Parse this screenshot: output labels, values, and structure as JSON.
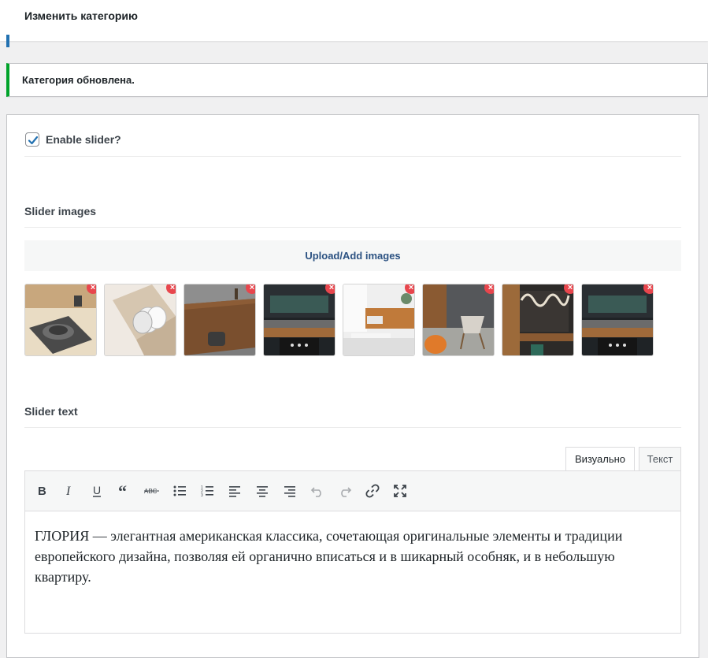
{
  "header": {
    "title": "Изменить категорию"
  },
  "notice": {
    "message": "Категория обновлена."
  },
  "slider": {
    "enable_label": "Enable slider?",
    "enabled": true,
    "images_title": "Slider images",
    "upload_label": "Upload/Add images",
    "remove_glyph": "×",
    "images": [
      {
        "icon": "dinnerware-plate-image"
      },
      {
        "icon": "drawer-plates-image"
      },
      {
        "icon": "wood-sideboard-image"
      },
      {
        "icon": "dark-kitchen-image"
      },
      {
        "icon": "living-room-sofa-image"
      },
      {
        "icon": "armchair-room-image"
      },
      {
        "icon": "wall-panel-interior-image"
      },
      {
        "icon": "dark-kitchen-image-2"
      }
    ],
    "text_title": "Slider text"
  },
  "editor": {
    "tabs": [
      {
        "label": "Визуально",
        "active": true
      },
      {
        "label": "Текст",
        "active": false
      }
    ],
    "toolbar": [
      "bold-icon",
      "italic-icon",
      "underline-icon",
      "blockquote-icon",
      "strikethrough-icon",
      "bullet-list-icon",
      "numbered-list-icon",
      "align-left-icon",
      "align-center-icon",
      "align-right-icon",
      "undo-icon",
      "redo-icon",
      "link-icon",
      "fullscreen-icon"
    ],
    "content": "ГЛОРИЯ — элегантная американская классика, сочетающая оригинальные элементы и традиции европейского дизайна, позволяя ей органично вписаться и в шикарный особняк, и в небольшую квартиру."
  },
  "colors": {
    "accent": "#2271b1",
    "success": "#00a32a",
    "remove": "#e8464d"
  }
}
